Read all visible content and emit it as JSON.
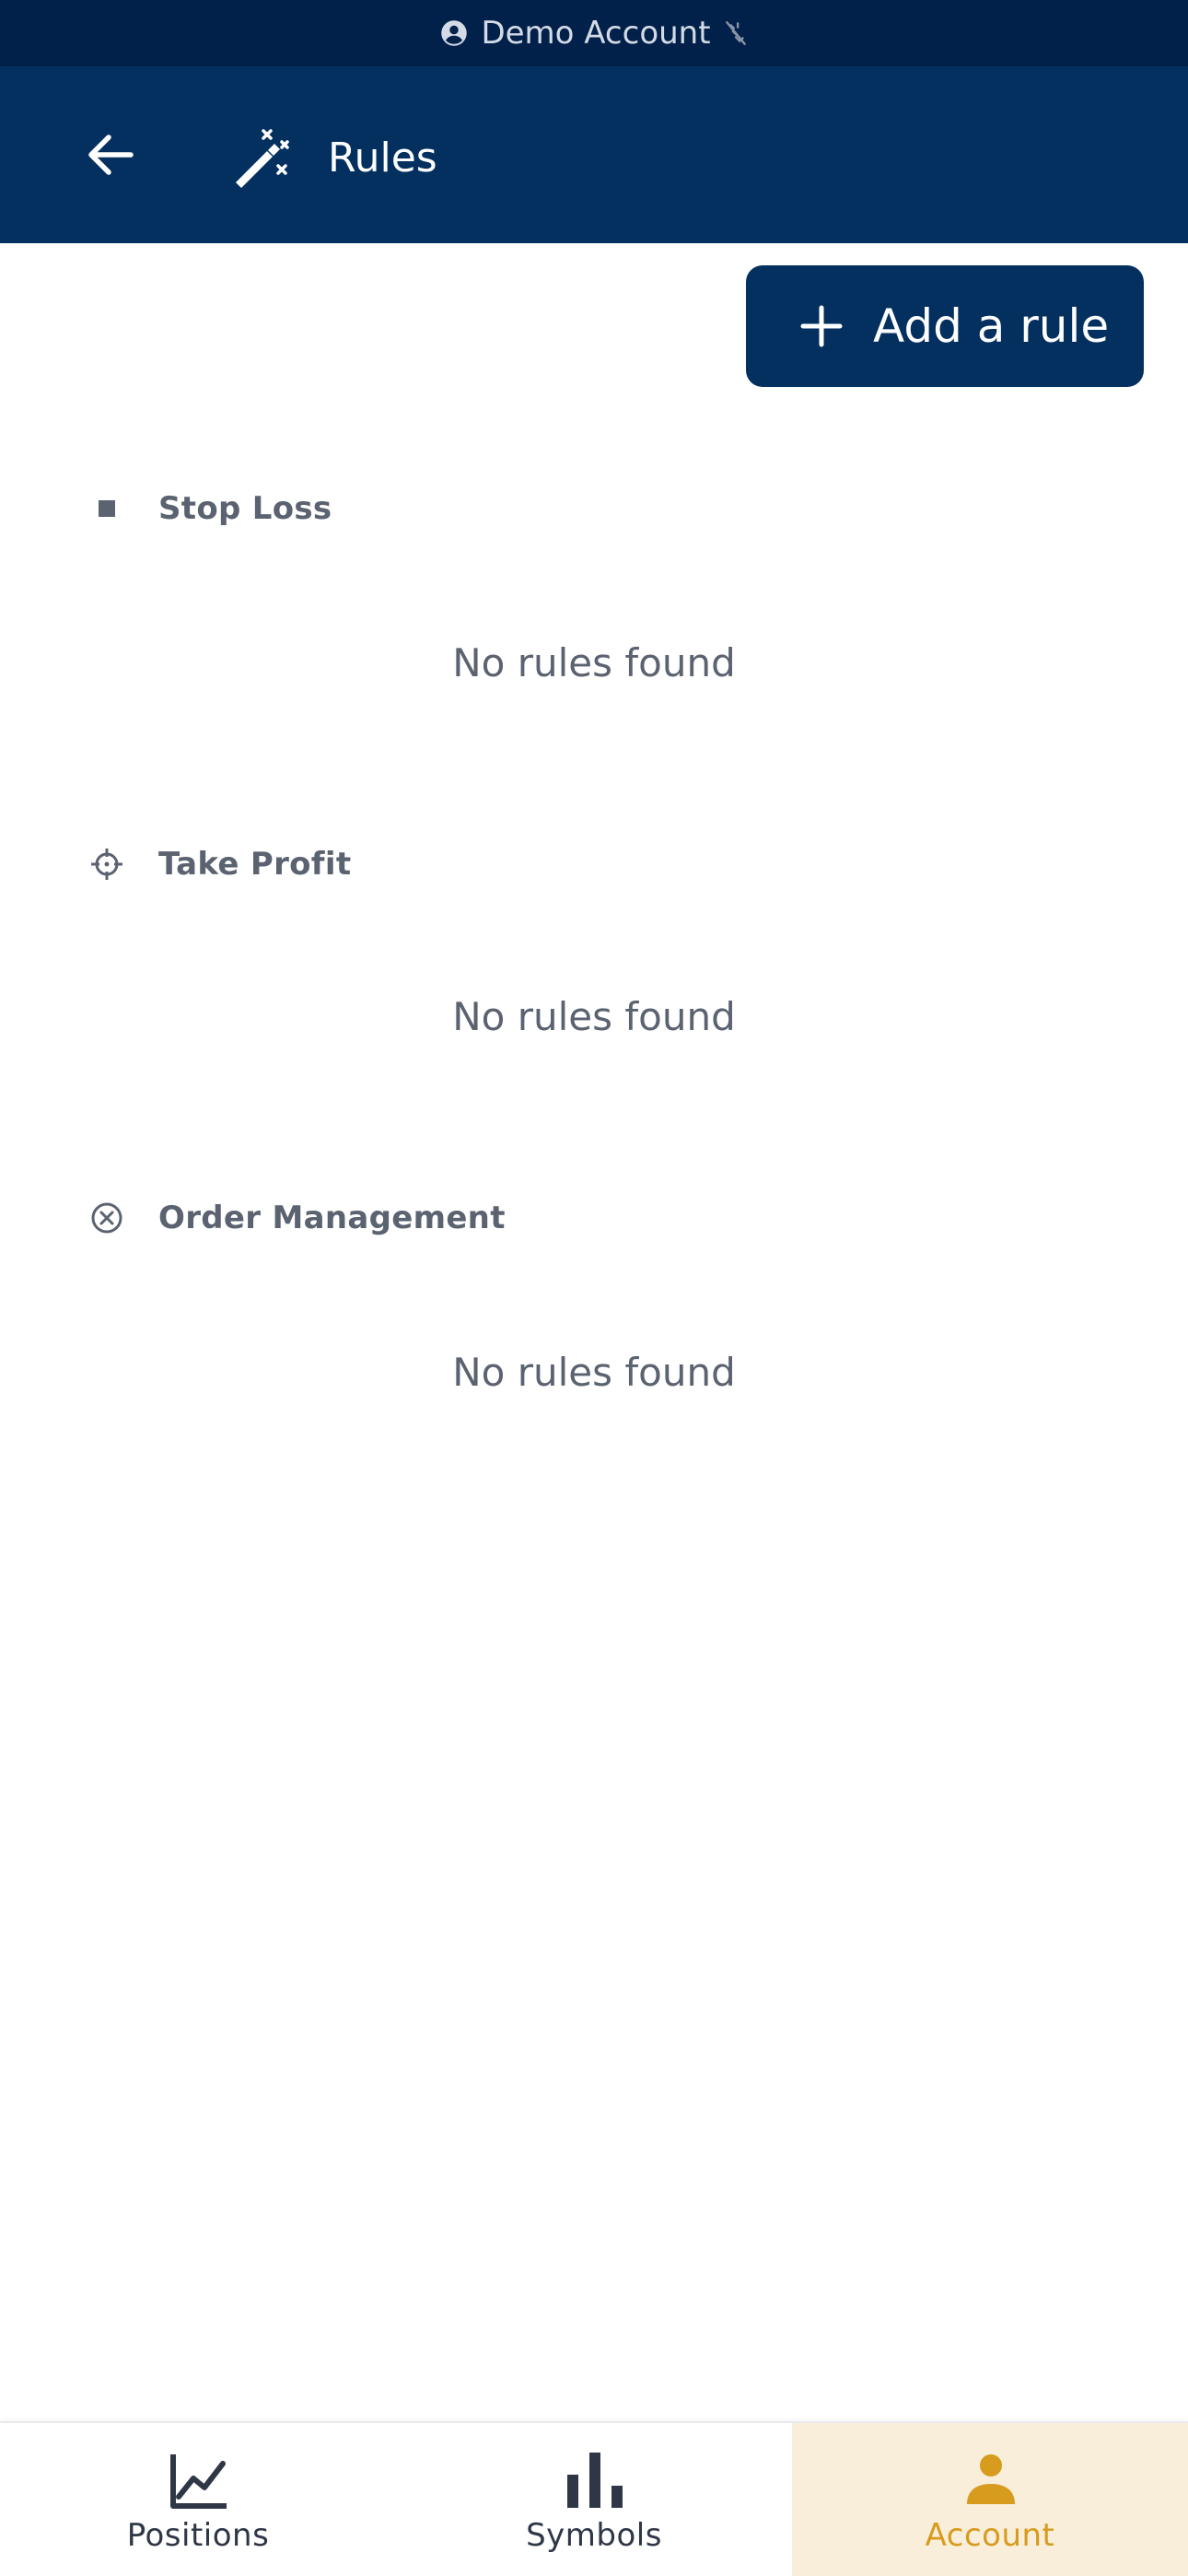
{
  "banner": {
    "account_label": "Demo Account",
    "icons": [
      "account-circle-icon",
      "link-off-icon"
    ]
  },
  "header": {
    "title": "Rules",
    "icons": [
      "back-arrow-icon",
      "magic-wand-icon"
    ]
  },
  "actions": {
    "add_rule_label": "Add a rule"
  },
  "sections": [
    {
      "title": "Stop Loss",
      "empty_text": "No rules found",
      "icon": "stop-square-icon"
    },
    {
      "title": "Take Profit",
      "empty_text": "No rules found",
      "icon": "crosshair-icon"
    },
    {
      "title": "Order Management",
      "empty_text": "No rules found",
      "icon": "cancel-circle-icon"
    }
  ],
  "bottom_nav": {
    "items": [
      {
        "label": "Positions",
        "icon": "line-chart-icon",
        "active": false
      },
      {
        "label": "Symbols",
        "icon": "bar-chart-icon",
        "active": false
      },
      {
        "label": "Account",
        "icon": "person-icon",
        "active": true
      }
    ]
  },
  "colors": {
    "banner_bg": "#02214a",
    "header_bg": "#03305f",
    "button_bg": "#03305f",
    "muted_text": "#5b6270",
    "active_nav_bg": "#f9eed9",
    "active_nav_accent": "#d79b1e"
  }
}
